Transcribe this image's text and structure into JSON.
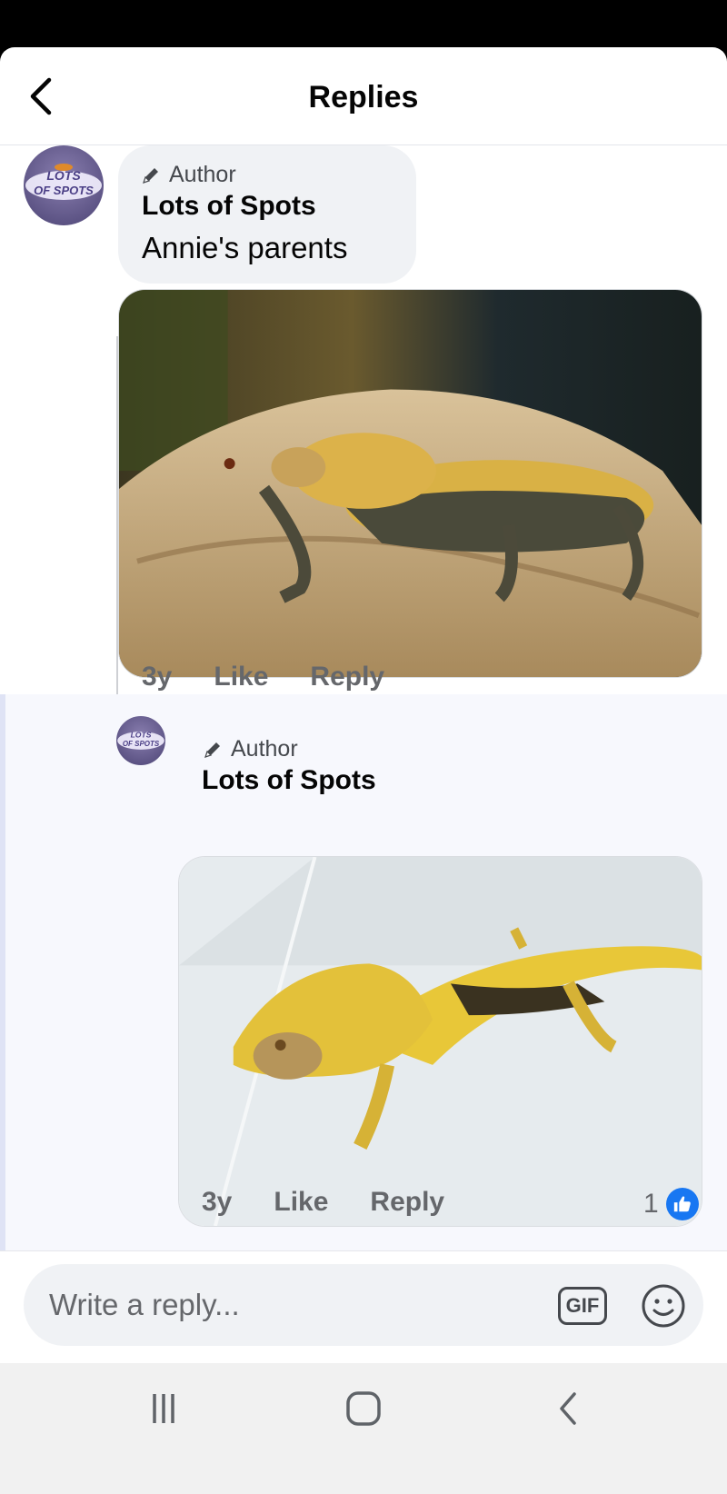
{
  "header": {
    "title": "Replies",
    "back_icon": "chevron-left-icon"
  },
  "comment": {
    "badge": "Author",
    "name": "Lots of Spots",
    "text": "Annie's parents",
    "avatar_text": [
      "LOTS",
      "OF SPOTS"
    ],
    "time": "3y",
    "like_label": "Like",
    "reply_label": "Reply"
  },
  "reply": {
    "badge": "Author",
    "name": "Lots of Spots",
    "avatar_text": [
      "LOTS",
      "OF SPOTS"
    ],
    "time": "3y",
    "like_label": "Like",
    "reply_label": "Reply",
    "reaction_count": "1",
    "reaction_icon": "thumbs-up-icon"
  },
  "composer": {
    "placeholder": "Write a reply...",
    "gif_label": "GIF",
    "emoji_icon": "smiley-icon"
  },
  "system_nav": [
    "recent-apps-icon",
    "home-icon",
    "back-icon"
  ],
  "colors": {
    "brand_blue": "#1877f2",
    "bubble_bg": "#f0f2f5",
    "secondary_text": "#65676b"
  }
}
